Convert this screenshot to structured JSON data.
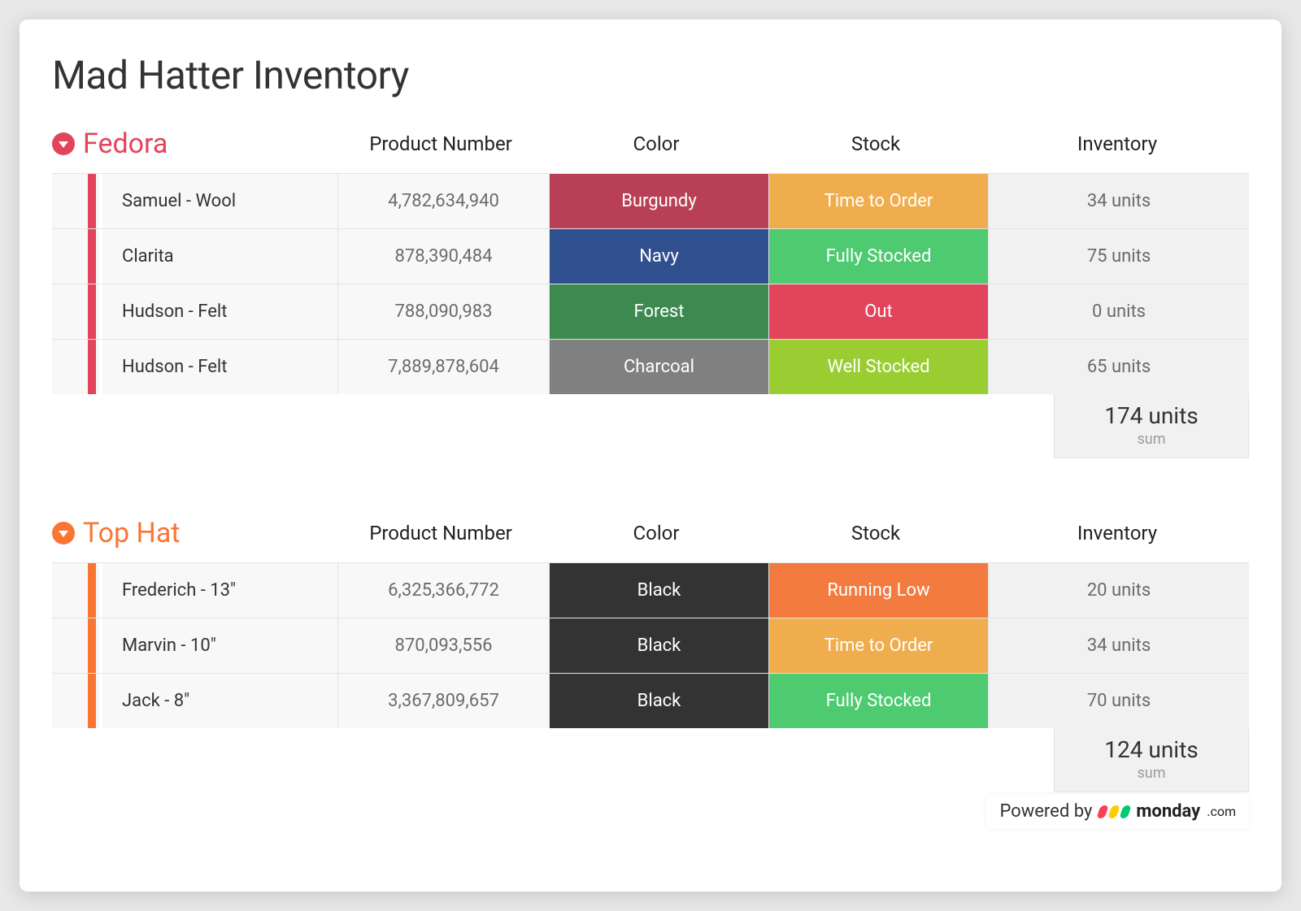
{
  "boardTitle": "Mad Hatter Inventory",
  "columns": [
    "Product Number",
    "Color",
    "Stock",
    "Inventory"
  ],
  "colors": {
    "fedoraAccent": "#e2445c",
    "topHatAccent": "#fb7532",
    "burgundy": "#b84056",
    "navy": "#2f4f8f",
    "forest": "#3c8a50",
    "charcoal": "#808080",
    "black": "#333333",
    "timeToOrder": "#f0ad4e",
    "fullyStocked": "#4ecb71",
    "out": "#e2445c",
    "wellStocked": "#9acd32",
    "runningLow": "#f47b3f"
  },
  "groups": [
    {
      "name": "Fedora",
      "accent": "fedoraAccent",
      "rows": [
        {
          "name": "Samuel - Wool",
          "pn": "4,782,634,940",
          "color": "Burgundy",
          "colorKey": "burgundy",
          "stock": "Time to Order",
          "stockKey": "timeToOrder",
          "inventory": "34 units"
        },
        {
          "name": "Clarita",
          "pn": "878,390,484",
          "color": "Navy",
          "colorKey": "navy",
          "stock": "Fully Stocked",
          "stockKey": "fullyStocked",
          "inventory": "75 units"
        },
        {
          "name": "Hudson - Felt",
          "pn": "788,090,983",
          "color": "Forest",
          "colorKey": "forest",
          "stock": "Out",
          "stockKey": "out",
          "inventory": "0 units"
        },
        {
          "name": "Hudson - Felt",
          "pn": "7,889,878,604",
          "color": "Charcoal",
          "colorKey": "charcoal",
          "stock": "Well Stocked",
          "stockKey": "wellStocked",
          "inventory": "65 units"
        }
      ],
      "summary": {
        "value": "174 units",
        "label": "sum"
      }
    },
    {
      "name": "Top Hat",
      "accent": "topHatAccent",
      "rows": [
        {
          "name": "Frederich - 13\"",
          "pn": "6,325,366,772",
          "color": "Black",
          "colorKey": "black",
          "stock": "Running Low",
          "stockKey": "runningLow",
          "inventory": "20 units"
        },
        {
          "name": "Marvin - 10\"",
          "pn": "870,093,556",
          "color": "Black",
          "colorKey": "black",
          "stock": "Time to Order",
          "stockKey": "timeToOrder",
          "inventory": "34 units"
        },
        {
          "name": "Jack - 8\"",
          "pn": "3,367,809,657",
          "color": "Black",
          "colorKey": "black",
          "stock": "Fully Stocked",
          "stockKey": "fullyStocked",
          "inventory": "70 units"
        }
      ],
      "summary": {
        "value": "124 units",
        "label": "sum"
      }
    }
  ],
  "poweredBy": {
    "prefix": "Powered by",
    "brand": "monday",
    "suffix": ".com"
  }
}
